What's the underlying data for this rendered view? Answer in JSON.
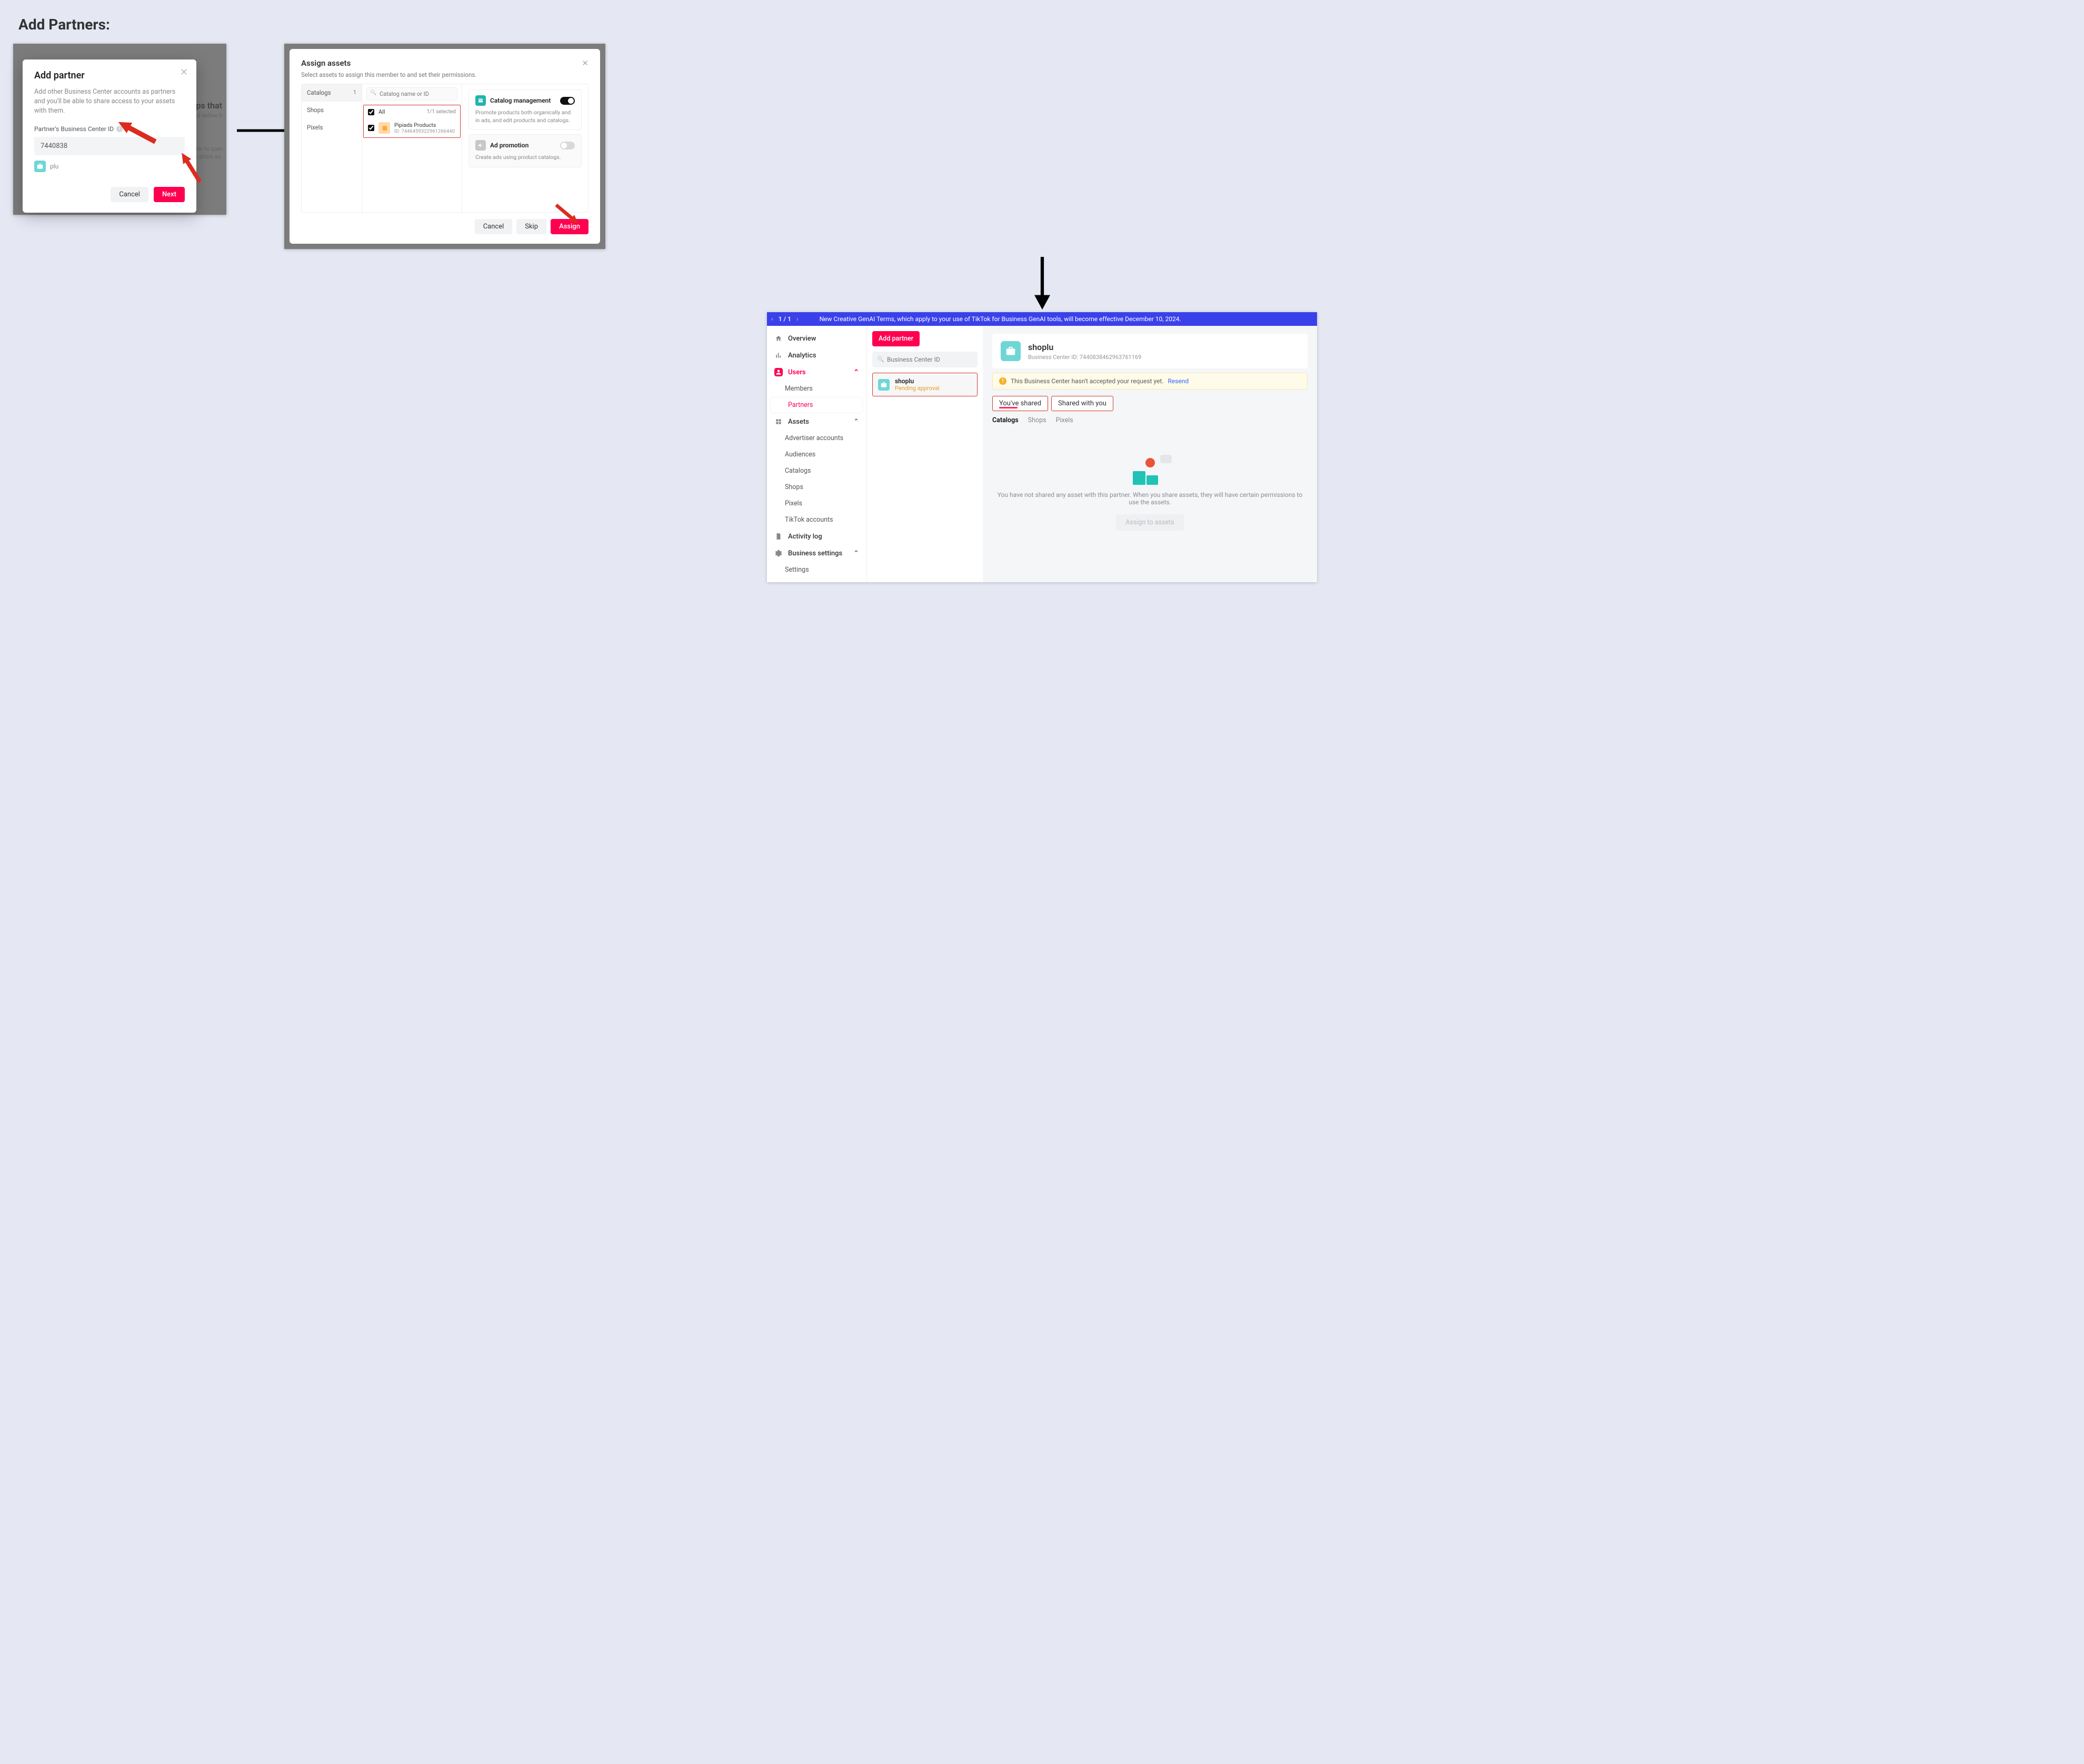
{
  "page": {
    "title": "Add Partners:"
  },
  "modal1": {
    "title": "Add partner",
    "desc": "Add other Business Center accounts as partners and you'll be able to share access to your assets with them.",
    "label": "Partner's Business Center ID",
    "value": "7440838",
    "match_name": "plu",
    "bg_headline": "ips that",
    "bg_line1": "urs and define h",
    "bg_line2a": "s Center to spec",
    "bg_line2b": "sier to share as",
    "cancel": "Cancel",
    "next": "Next"
  },
  "modal2": {
    "title": "Assign assets",
    "desc": "Select assets to assign this member to and set their permissions.",
    "side": [
      {
        "label": "Catalogs",
        "count": "1",
        "active": true
      },
      {
        "label": "Shops"
      },
      {
        "label": "Pixels"
      }
    ],
    "search_placeholder": "Catalog name or ID",
    "all_label": "All",
    "all_counter": "1/1  selected",
    "item": {
      "name": "Pipiads Products",
      "id": "ID: 7446459322961266440"
    },
    "perm1": {
      "title": "Catalog management",
      "desc": "Promote products both organically and in ads, and edit products and catalogs.",
      "on": true
    },
    "perm2": {
      "title": "Ad promotion",
      "desc": "Create ads using product catalogs.",
      "on": false
    },
    "cancel": "Cancel",
    "skip": "Skip",
    "assign": "Assign"
  },
  "bc": {
    "banner_pager": "1  /  1",
    "banner_text": "New Creative GenAI Terms, which apply to your use of TikTok for Business GenAI tools, will become effective December 10, 2024.",
    "nav": {
      "overview": "Overview",
      "analytics": "Analytics",
      "users": "Users",
      "members": "Members",
      "partners": "Partners",
      "assets": "Assets",
      "advertiser": "Advertiser accounts",
      "audiences": "Audiences",
      "catalogs": "Catalogs",
      "shops": "Shops",
      "pixels": "Pixels",
      "tiktok": "TikTok accounts",
      "activity": "Activity log",
      "settings_section": "Business settings",
      "settings": "Settings"
    },
    "add_partner": "Add partner",
    "search_placeholder": "Business Center ID",
    "card": {
      "name": "shoplu",
      "status": "Pending approval"
    },
    "header": {
      "name": "shoplu",
      "sub_prefix": "Business Center ID:",
      "id": "7440838462963761169"
    },
    "warn": {
      "text": "This Business Center hasn't accepted your request yet.",
      "link": "Resend"
    },
    "tabs": {
      "shared": "You've shared",
      "with_you": "Shared with you"
    },
    "subtabs": {
      "catalogs": "Catalogs",
      "shops": "Shops",
      "pixels": "Pixels"
    },
    "empty": {
      "line": "You have not shared any asset with this partner. When you share assets, they will have certain permissions to use the assets.",
      "button": "Assign to assets"
    }
  }
}
